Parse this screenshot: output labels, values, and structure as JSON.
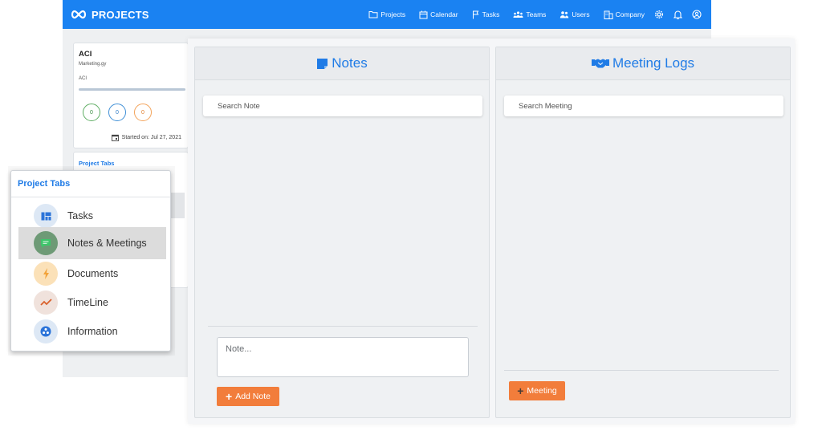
{
  "app": {
    "brand": "PROJECTS",
    "accent_color": "#1a82f2"
  },
  "nav": {
    "items": [
      {
        "label": "Projects",
        "icon": "folder-icon"
      },
      {
        "label": "Calendar",
        "icon": "calendar-icon"
      },
      {
        "label": "Tasks",
        "icon": "flag-icon"
      },
      {
        "label": "Teams",
        "icon": "teams-icon"
      },
      {
        "label": "Users",
        "icon": "users-icon"
      },
      {
        "label": "Company",
        "icon": "building-icon"
      }
    ],
    "icons": [
      "gear-icon",
      "bell-icon",
      "account-icon"
    ]
  },
  "project": {
    "name": "ACI",
    "subtitle": "Marketing.gy",
    "code": "ACI",
    "progress_fraction": 1.0,
    "counts": [
      "0",
      "0",
      "0"
    ],
    "started_on": "Started on: Jul 27, 2021"
  },
  "tabs_card": {
    "title": "Project Tabs"
  },
  "popup": {
    "title": "Project Tabs",
    "items": [
      {
        "label": "Tasks",
        "icon": "board-icon",
        "bg": "#dde8f5",
        "fg": "#2a73d9"
      },
      {
        "label": "Notes & Meetings",
        "icon": "chat-icon",
        "bg": "#6e9a76",
        "fg": "#3ec56a",
        "selected": true
      },
      {
        "label": "Documents",
        "icon": "bolt-icon",
        "bg": "#fbe1b8",
        "fg": "#f2a33a"
      },
      {
        "label": "TimeLine",
        "icon": "trend-icon",
        "bg": "#f0e2dc",
        "fg": "#d9622d"
      },
      {
        "label": "Information",
        "icon": "info-dots-icon",
        "bg": "#dde8f5",
        "fg": "#2a73d9"
      }
    ]
  },
  "notes": {
    "title": "Notes",
    "search_placeholder": "Search Note",
    "textarea_placeholder": "Note...",
    "add_label": "Add Note"
  },
  "meetings": {
    "title": "Meeting Logs",
    "search_placeholder": "Search Meeting",
    "add_label": "Meeting"
  },
  "colors": {
    "title_blue": "#1f7be6",
    "button_orange": "#f27d3b"
  }
}
